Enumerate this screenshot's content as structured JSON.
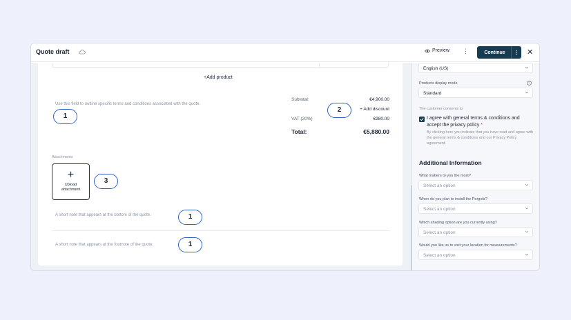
{
  "header": {
    "title": "Quote draft",
    "preview_label": "Preview",
    "continue_label": "Continue"
  },
  "main": {
    "add_product_label": "+Add product",
    "terms_placeholder": "Use this field to outline specific terms and conditions associated with the quote.",
    "totals": {
      "subtotal_label": "Subtotal:",
      "subtotal_value": "€4,900.00",
      "add_discount_label": "+ Add discount",
      "vat_label": "VAT (20%)",
      "vat_value": "€980.00",
      "total_label": "Total:",
      "total_value": "€5,880.00"
    },
    "attachments_label": "Attachments",
    "upload_label": "Upload attachment",
    "bottom_note_placeholder": "A short note that appears at the bottom of the quote.",
    "footnote_placeholder": "A short note that appears at the footnote of the quote."
  },
  "callouts": {
    "terms": "1",
    "discount": "2",
    "upload": "3",
    "bottom_note": "1",
    "footnote": "1"
  },
  "sidebar": {
    "language_value": "English (US)",
    "display_mode_label": "Products display mode",
    "display_mode_value": "Standard",
    "consent_section_label": "The customer consents to",
    "consent_text": "I agree with general terms & conditions and accept the privacy policy",
    "consent_required_mark": "*",
    "consent_help": "By clicking here you indicate that you have read and agree with the general terms & conditions and our Privacy Policy agreement.",
    "consent_checked": true,
    "additional_title": "Additional Information",
    "questions": [
      {
        "label": "What matters to you the most?",
        "placeholder": "Select an option"
      },
      {
        "label": "When do you plan to install the Pergola?",
        "placeholder": "Select an option"
      },
      {
        "label": "Which shading option are you currently using?",
        "placeholder": "Select an option"
      },
      {
        "label": "Would you like us to visit your location for measurements?",
        "placeholder": "Select an option"
      }
    ]
  },
  "colors": {
    "primary": "#173b51",
    "callout_border": "#2f62c7",
    "required": "#e0353f",
    "background": "#eef1fb"
  },
  "icons": [
    "cloud-icon",
    "eye-icon",
    "more-icon",
    "close-icon",
    "chevron-down-icon",
    "info-icon",
    "check-icon",
    "plus-icon"
  ]
}
